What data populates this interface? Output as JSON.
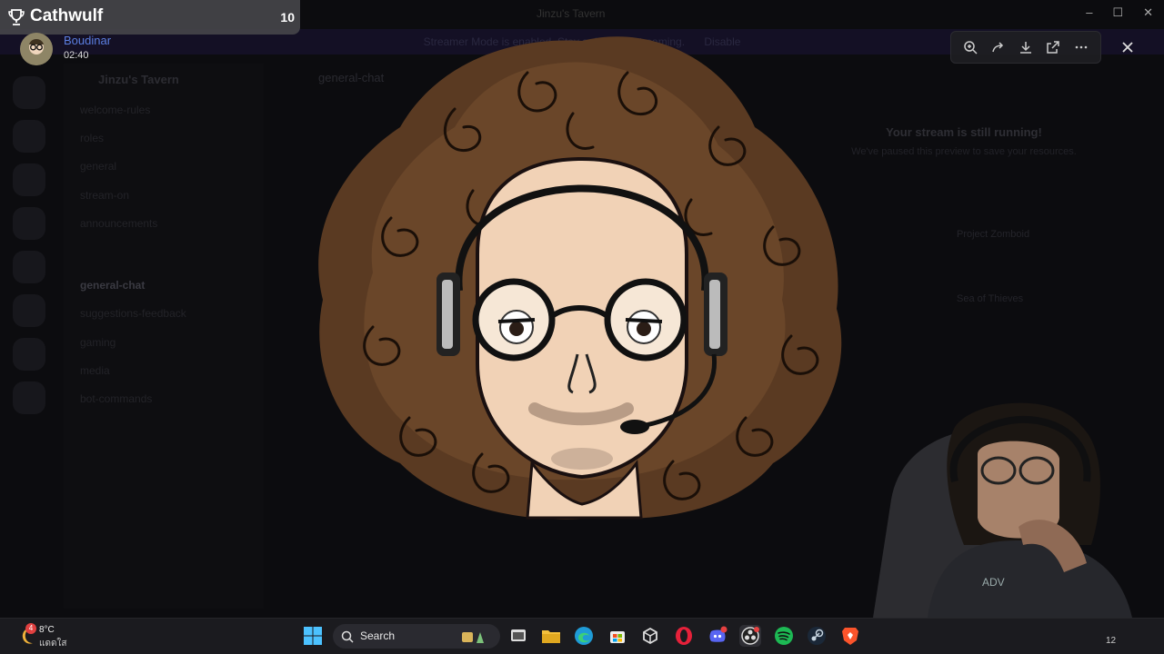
{
  "window": {
    "title": "Jinzu's Tavern"
  },
  "banner": {
    "text": "Streamer Mode is enabled. Stay safe while streaming.",
    "button": "Disable"
  },
  "server": {
    "name": "Jinzu's Tavern",
    "channels": [
      "welcome-rules",
      "roles",
      "general",
      "stream-on",
      "announcements",
      "general-chat",
      "suggestions-feedback",
      "gaming",
      "media",
      "bot-commands"
    ],
    "active_channel": "general-chat"
  },
  "chat": {
    "title": "general-chat"
  },
  "stream": {
    "paused_title": "Your stream is still running!",
    "paused_sub": "We've paused this preview to save your resources."
  },
  "activity": [
    "Project Zomboid",
    "Sea of Thieves"
  ],
  "notification": {
    "name": "Cathwulf",
    "count": "10",
    "icon": "trophy-icon"
  },
  "streamer": {
    "username": "Boudinar",
    "elapsed": "02:40"
  },
  "toolbar": {
    "zoom_icon": "zoom-in-icon",
    "share_icon": "share-icon",
    "download_icon": "download-icon",
    "open_icon": "open-external-icon",
    "more_icon": "more-icon",
    "close_icon": "close-icon"
  },
  "taskbar": {
    "weather_temp": "8°C",
    "weather_desc": "แดดใส",
    "weather_badge": "4",
    "search_label": "Search",
    "tray_label": "12"
  }
}
